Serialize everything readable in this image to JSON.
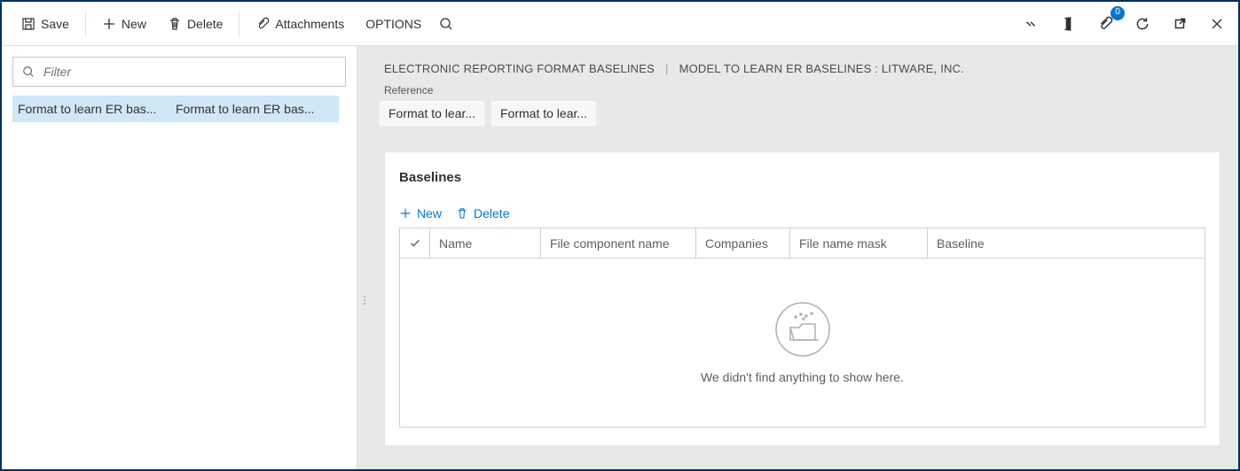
{
  "cmdbar": {
    "save": "Save",
    "new": "New",
    "delete": "Delete",
    "attachments": "Attachments",
    "options": "OPTIONS",
    "attach_badge": "0"
  },
  "filter": {
    "placeholder": "Filter"
  },
  "list": {
    "row0": {
      "col0": "Format to learn ER bas...",
      "col1": "Format to learn ER bas..."
    }
  },
  "breadcrumb": {
    "a": "ELECTRONIC REPORTING FORMAT BASELINES",
    "b": "MODEL TO LEARN ER BASELINES : LITWARE, INC."
  },
  "reference": {
    "label": "Reference",
    "chip0": "Format to lear...",
    "chip1": "Format to lear..."
  },
  "card": {
    "title": "Baselines",
    "new": "New",
    "delete": "Delete",
    "grid": {
      "col_name": "Name",
      "col_file_component": "File component name",
      "col_companies": "Companies",
      "col_mask": "File name mask",
      "col_baseline": "Baseline"
    },
    "empty": "We didn't find anything to show here."
  }
}
